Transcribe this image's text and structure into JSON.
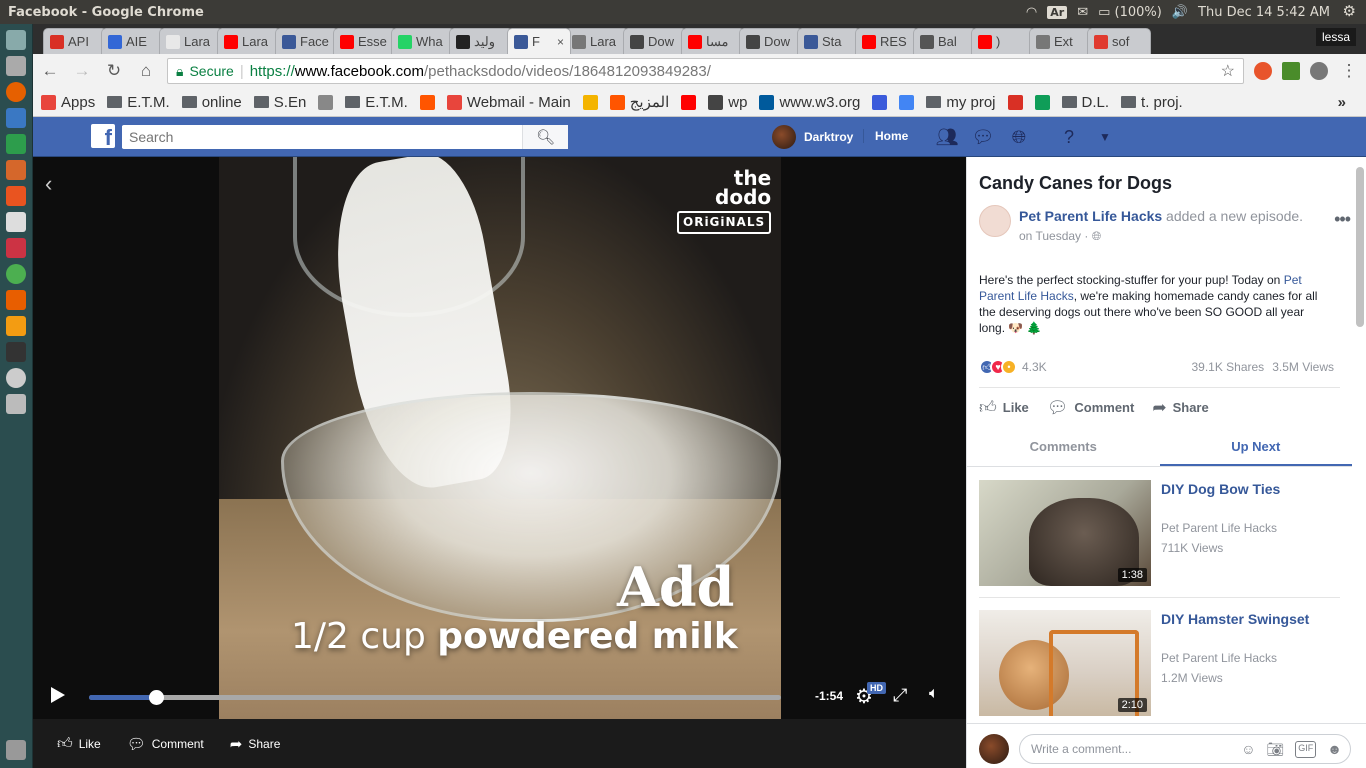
{
  "os": {
    "window_title": "Facebook - Google Chrome",
    "keyboard": "Ar",
    "battery": "(100%)",
    "clock": "Thu Dec 14  5:42 AM"
  },
  "browser": {
    "tabs": [
      {
        "label": "API",
        "color": "#d93025"
      },
      {
        "label": "AIE",
        "color": "#3367d6"
      },
      {
        "label": "Lara",
        "color": "#e8e8e8"
      },
      {
        "label": "Lara",
        "color": "#ff0000"
      },
      {
        "label": "Face",
        "color": "#3b5998"
      },
      {
        "label": "Esse",
        "color": "#ff0000"
      },
      {
        "label": "Wha",
        "color": "#25d366"
      },
      {
        "label": "وليد",
        "color": "#222222"
      },
      {
        "label": "F",
        "color": "#3b5998",
        "active": true
      },
      {
        "label": "Lara",
        "color": "#777777"
      },
      {
        "label": "Dow",
        "color": "#444444"
      },
      {
        "label": "مسا",
        "color": "#ff0000"
      },
      {
        "label": "Dow",
        "color": "#444444"
      },
      {
        "label": "Sta",
        "color": "#3b5998"
      },
      {
        "label": "RES",
        "color": "#ff0000"
      },
      {
        "label": "Bal",
        "color": "#555555"
      },
      {
        "label": ")",
        "color": "#ff0000"
      },
      {
        "label": "Ext",
        "color": "#777777"
      },
      {
        "label": "sof",
        "color": "#e03a2f"
      }
    ],
    "profile_name": "lessa",
    "address": {
      "secure_label": "Secure",
      "url_prefix": "https://",
      "url_domain": "www.facebook.com",
      "url_path": "/pethacksdodo/videos/1864812093849283/"
    },
    "bookmarks": [
      {
        "label": "Apps",
        "kind": "apps"
      },
      {
        "label": "E.T.M.",
        "kind": "folder"
      },
      {
        "label": "online",
        "kind": "folder"
      },
      {
        "label": "S.En",
        "kind": "folder"
      },
      {
        "label": "",
        "kind": "page"
      },
      {
        "label": "E.T.M.",
        "kind": "folder"
      },
      {
        "label": "",
        "kind": "soundcloud"
      },
      {
        "label": "Webmail - Main",
        "kind": "link"
      },
      {
        "label": "",
        "kind": "icon"
      },
      {
        "label": "المزيج",
        "kind": "soundcloud"
      },
      {
        "label": "",
        "kind": "youtube"
      },
      {
        "label": "wp",
        "kind": "download"
      },
      {
        "label": "www.w3.org",
        "kind": "w3"
      },
      {
        "label": "",
        "kind": "cloud"
      },
      {
        "label": "",
        "kind": "google"
      },
      {
        "label": "my proj",
        "kind": "folder"
      },
      {
        "label": "",
        "kind": "gmail"
      },
      {
        "label": "",
        "kind": "drive"
      },
      {
        "label": "D.L.",
        "kind": "folder"
      },
      {
        "label": "t. proj.",
        "kind": "folder"
      }
    ],
    "bookmarks_overflow": "»"
  },
  "facebook": {
    "search_placeholder": "Search",
    "user_name": "Darktroy",
    "home_label": "Home",
    "video": {
      "logo_line1": "the",
      "logo_line2": "dodo",
      "logo_sub": "ORiGiNALS",
      "caption_word": "Add",
      "caption_amount": "1/2 cup ",
      "caption_item": "powdered milk",
      "time_remaining": "-1:54",
      "hd_badge": "HD",
      "progress_fraction": 0.097
    },
    "video_actions": {
      "like": "Like",
      "comment": "Comment",
      "share": "Share"
    },
    "side": {
      "title": "Candy Canes for Dogs",
      "page_name": "Pet Parent Life Hacks",
      "post_action": " added a new episode.",
      "when": "on Tuesday · ",
      "desc_before": "Here's the perfect stocking-stuffer for your pup! Today on ",
      "desc_link": "Pet Parent Life Hacks",
      "desc_after": ", we're making homemade candy canes for all the deserving dogs out there who've been SO GOOD all year long. 🐶 🌲",
      "reaction_count": "4.3K",
      "shares": "39.1K Shares",
      "views": "3.5M Views",
      "actions": {
        "like": "Like",
        "comment": "Comment",
        "share": "Share"
      },
      "tabs": {
        "comments": "Comments",
        "up_next": "Up Next"
      },
      "up_next": [
        {
          "title": "DIY Dog Bow Ties",
          "page": "Pet Parent Life Hacks",
          "views": "711K Views",
          "duration": "1:38"
        },
        {
          "title": "DIY Hamster Swingset",
          "page": "Pet Parent Life Hacks",
          "views": "1.2M Views",
          "duration": "2:10"
        }
      ],
      "comment_placeholder": "Write a comment..."
    }
  }
}
